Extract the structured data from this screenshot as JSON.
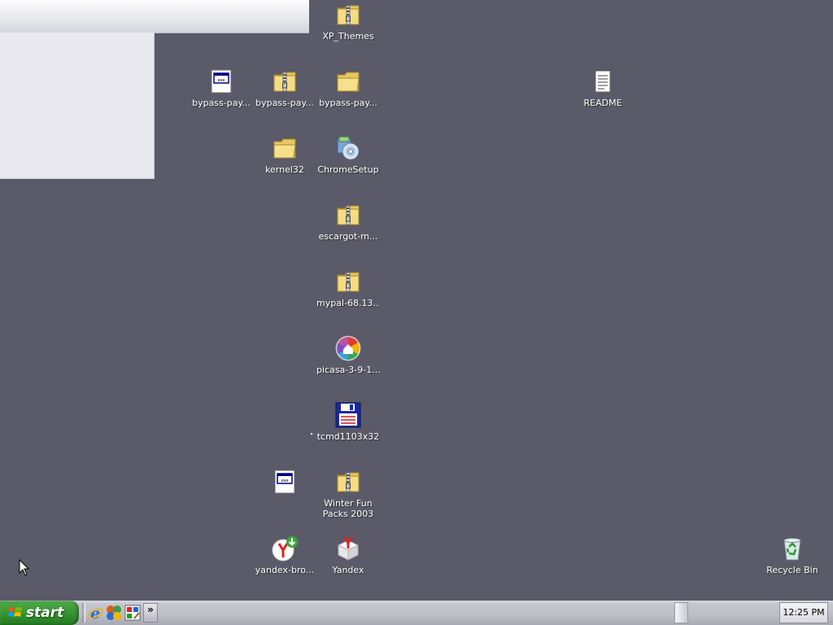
{
  "desktop": {
    "background_color": "#5a5a68",
    "icons": [
      {
        "label": "XP_Themes",
        "icon": "zip-folder-icon"
      },
      {
        "label": "bypass-pay...",
        "icon": "application-window-icon"
      },
      {
        "label": "bypass-pay...",
        "icon": "zip-folder-icon"
      },
      {
        "label": "bypass-pay...",
        "icon": "folder-icon"
      },
      {
        "label": "README",
        "icon": "text-document-icon"
      },
      {
        "label": "kernel32",
        "icon": "folder-icon"
      },
      {
        "label": "ChromeSetup",
        "icon": "setup-disc-icon"
      },
      {
        "label": "escargot-m...",
        "icon": "zip-folder-icon"
      },
      {
        "label": "mypal-68.13...",
        "icon": "zip-folder-icon"
      },
      {
        "label": "picasa-3-9-1...",
        "icon": "picasa-icon"
      },
      {
        "label": "tcmd1103x32",
        "icon": "floppy-disk-icon"
      },
      {
        "label": "",
        "icon": "application-window-icon"
      },
      {
        "label": "Winter Fun Packs 2003",
        "icon": "zip-folder-icon"
      },
      {
        "label": "yandex-bro...",
        "icon": "yandex-browser-installer-icon"
      },
      {
        "label": "Yandex",
        "icon": "yandex-box-icon"
      },
      {
        "label": "Recycle Bin",
        "icon": "recycle-bin-icon"
      }
    ]
  },
  "taskbar": {
    "start_label": "start",
    "start_color": "#3c9b37",
    "quick_launch": [
      {
        "icon": "internet-explorer-icon"
      },
      {
        "icon": "windows-media-icon"
      },
      {
        "icon": "paint-icon"
      }
    ],
    "overflow_glyph": "»",
    "clock": "12:25 PM"
  }
}
